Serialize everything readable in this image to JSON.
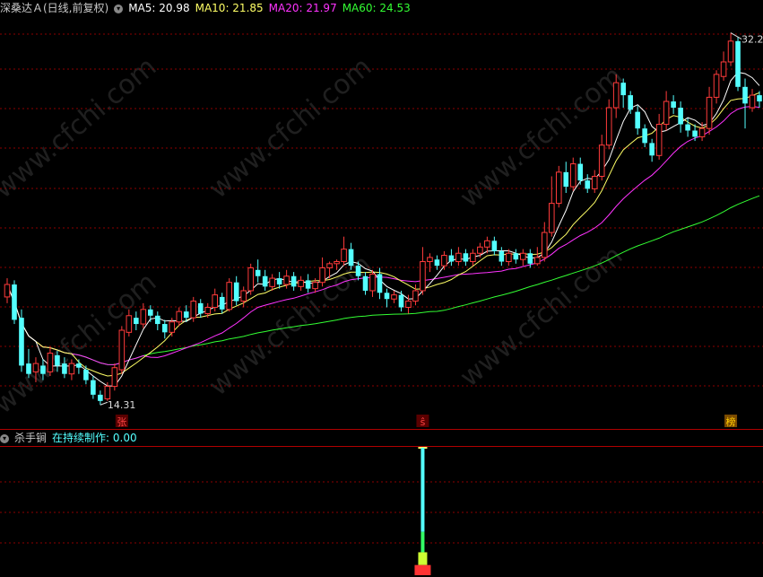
{
  "main_header": {
    "title": "深桑达Ａ(日线,前复权)",
    "ma5_label": "MA5: 20.98",
    "ma10_label": "MA10: 21.85",
    "ma20_label": "MA20: 21.97",
    "ma60_label": "MA60: 24.53"
  },
  "sub_header": {
    "title": "杀手锏",
    "line_label": "在持续制作: 0.00"
  },
  "watermark": "www.cfchi.com",
  "colors": {
    "up": "#ff3b3b",
    "down": "#54ffff",
    "ma5": "#ffffff",
    "ma10": "#ffff66",
    "ma20": "#ff33ff",
    "ma60": "#33ff33",
    "grid": "#8b0000",
    "axis": "#b00000",
    "title": "#c8c8c8",
    "sub_label": "#54ffff"
  },
  "chart_data": [
    {
      "type": "candlestick",
      "price_range": [
        13.5,
        33.0
      ],
      "high_marker": "32.20",
      "low_marker": "14.31",
      "signals": [
        {
          "index": 16,
          "label": "张",
          "color": "#ff4444"
        },
        {
          "index": 58,
          "label": "ŝ",
          "color": "#ff4444"
        },
        {
          "index": 101,
          "label": "榜",
          "color": "#ffcc00"
        }
      ],
      "candles": [
        [
          19.5,
          20.1,
          20.4,
          19.2
        ],
        [
          20.1,
          18.4,
          20.3,
          18.2
        ],
        [
          18.5,
          16.2,
          18.9,
          15.9
        ],
        [
          16.3,
          15.8,
          17.0,
          15.6
        ],
        [
          15.9,
          16.3,
          16.6,
          15.4
        ],
        [
          16.2,
          15.8,
          16.5,
          15.5
        ],
        [
          15.9,
          16.8,
          17.1,
          15.7
        ],
        [
          16.7,
          16.2,
          16.9,
          15.9
        ],
        [
          16.3,
          15.8,
          16.6,
          15.6
        ],
        [
          15.8,
          16.3,
          16.5,
          15.5
        ],
        [
          16.3,
          16.1,
          16.5,
          15.8
        ],
        [
          16.0,
          15.5,
          16.2,
          15.3
        ],
        [
          15.5,
          14.8,
          15.7,
          14.6
        ],
        [
          14.8,
          14.5,
          15.0,
          14.31
        ],
        [
          14.6,
          15.2,
          15.4,
          14.5
        ],
        [
          15.2,
          16.1,
          16.3,
          15.0
        ],
        [
          16.0,
          17.9,
          18.1,
          15.8
        ],
        [
          17.8,
          18.6,
          18.9,
          17.6
        ],
        [
          18.5,
          18.2,
          18.8,
          17.9
        ],
        [
          18.2,
          18.9,
          19.2,
          18.0
        ],
        [
          18.9,
          18.6,
          19.1,
          18.3
        ],
        [
          18.6,
          18.2,
          18.8,
          17.9
        ],
        [
          18.2,
          17.8,
          18.4,
          17.5
        ],
        [
          17.8,
          18.3,
          18.5,
          17.6
        ],
        [
          18.3,
          18.8,
          19.0,
          18.1
        ],
        [
          18.8,
          18.5,
          19.1,
          18.3
        ],
        [
          18.5,
          19.3,
          19.5,
          18.3
        ],
        [
          19.2,
          18.7,
          19.4,
          18.5
        ],
        [
          18.7,
          19.0,
          19.2,
          18.5
        ],
        [
          19.0,
          19.6,
          19.9,
          18.8
        ],
        [
          19.5,
          18.9,
          19.7,
          18.7
        ],
        [
          18.9,
          20.2,
          20.4,
          18.8
        ],
        [
          20.2,
          19.3,
          20.5,
          19.1
        ],
        [
          19.3,
          19.8,
          20.0,
          19.0
        ],
        [
          19.8,
          20.9,
          21.1,
          19.6
        ],
        [
          20.8,
          20.5,
          21.3,
          20.2
        ],
        [
          20.5,
          20.0,
          20.8,
          19.8
        ],
        [
          20.0,
          20.4,
          20.6,
          19.8
        ],
        [
          20.4,
          20.1,
          20.7,
          19.9
        ],
        [
          20.1,
          20.5,
          20.8,
          19.9
        ],
        [
          20.5,
          20.0,
          20.7,
          19.8
        ],
        [
          20.0,
          20.3,
          20.5,
          19.8
        ],
        [
          20.3,
          19.9,
          20.6,
          19.7
        ],
        [
          19.9,
          20.2,
          20.4,
          19.7
        ],
        [
          20.2,
          20.9,
          21.4,
          20.0
        ],
        [
          20.9,
          21.1,
          21.2,
          20.4
        ],
        [
          21.1,
          21.2,
          21.3,
          20.8
        ],
        [
          21.2,
          21.8,
          22.4,
          21.0
        ],
        [
          21.8,
          21.0,
          22.1,
          20.8
        ],
        [
          21.0,
          20.5,
          21.2,
          20.3
        ],
        [
          20.5,
          19.8,
          20.7,
          19.6
        ],
        [
          19.8,
          20.6,
          20.8,
          19.5
        ],
        [
          20.6,
          19.7,
          20.9,
          19.4
        ],
        [
          19.7,
          19.4,
          19.9,
          19.0
        ],
        [
          19.4,
          19.6,
          19.8,
          19.2
        ],
        [
          19.6,
          19.0,
          19.8,
          18.8
        ],
        [
          19.0,
          19.3,
          19.6,
          18.7
        ],
        [
          19.3,
          19.8,
          20.1,
          19.1
        ],
        [
          19.8,
          21.2,
          21.9,
          19.6
        ],
        [
          21.2,
          21.4,
          21.6,
          20.7
        ],
        [
          21.3,
          21.0,
          21.5,
          20.8
        ],
        [
          21.0,
          21.5,
          21.7,
          20.8
        ],
        [
          21.5,
          21.2,
          21.8,
          21.0
        ],
        [
          21.2,
          21.6,
          21.9,
          21.0
        ],
        [
          21.6,
          21.2,
          21.8,
          21.0
        ],
        [
          21.2,
          21.6,
          21.8,
          21.0
        ],
        [
          21.6,
          21.9,
          22.1,
          21.4
        ],
        [
          21.9,
          22.2,
          22.4,
          21.6
        ],
        [
          22.2,
          21.7,
          22.4,
          21.5
        ],
        [
          21.7,
          21.2,
          21.9,
          21.0
        ],
        [
          21.2,
          21.6,
          21.8,
          21.0
        ],
        [
          21.6,
          21.3,
          21.8,
          21.1
        ],
        [
          21.3,
          21.6,
          21.8,
          21.0
        ],
        [
          21.6,
          21.1,
          21.8,
          20.9
        ],
        [
          21.1,
          21.4,
          21.9,
          21.0
        ],
        [
          21.4,
          22.6,
          23.1,
          21.2
        ],
        [
          22.6,
          24.0,
          25.3,
          22.4
        ],
        [
          24.0,
          25.5,
          25.8,
          23.8
        ],
        [
          25.5,
          24.8,
          26.0,
          24.5
        ],
        [
          24.8,
          25.9,
          26.2,
          24.6
        ],
        [
          25.9,
          25.1,
          26.2,
          24.9
        ],
        [
          25.1,
          24.7,
          25.4,
          24.5
        ],
        [
          24.7,
          25.3,
          25.6,
          24.5
        ],
        [
          25.3,
          26.8,
          27.3,
          25.1
        ],
        [
          26.8,
          28.6,
          29.0,
          26.6
        ],
        [
          28.6,
          29.8,
          30.2,
          28.1
        ],
        [
          29.8,
          29.2,
          30.0,
          28.6
        ],
        [
          29.2,
          28.5,
          29.4,
          28.3
        ],
        [
          28.4,
          27.6,
          28.7,
          27.3
        ],
        [
          27.6,
          26.9,
          27.8,
          26.7
        ],
        [
          26.9,
          26.3,
          27.1,
          26.0
        ],
        [
          26.3,
          27.8,
          28.3,
          26.1
        ],
        [
          27.8,
          28.9,
          29.4,
          27.5
        ],
        [
          28.9,
          28.6,
          29.2,
          28.3
        ],
        [
          28.6,
          27.8,
          28.9,
          27.4
        ],
        [
          27.8,
          27.5,
          28.1,
          27.2
        ],
        [
          27.5,
          27.2,
          27.8,
          27.0
        ],
        [
          27.2,
          27.6,
          27.9,
          27.0
        ],
        [
          27.6,
          29.1,
          29.6,
          27.3
        ],
        [
          29.1,
          30.2,
          30.4,
          28.8
        ],
        [
          30.1,
          30.8,
          31.3,
          29.9
        ],
        [
          30.8,
          31.8,
          32.2,
          30.6
        ],
        [
          31.8,
          29.6,
          32.0,
          29.4
        ],
        [
          29.6,
          28.8,
          30.0,
          27.6
        ],
        [
          28.6,
          29.2,
          29.5,
          28.4
        ],
        [
          29.2,
          28.9,
          29.4,
          28.6
        ]
      ],
      "series": [
        {
          "name": "MA5"
        },
        {
          "name": "MA10"
        },
        {
          "name": "MA20"
        },
        {
          "name": "MA60"
        }
      ]
    },
    {
      "type": "bar",
      "name": "杀手锏",
      "index": 58,
      "value": 1.0
    }
  ]
}
